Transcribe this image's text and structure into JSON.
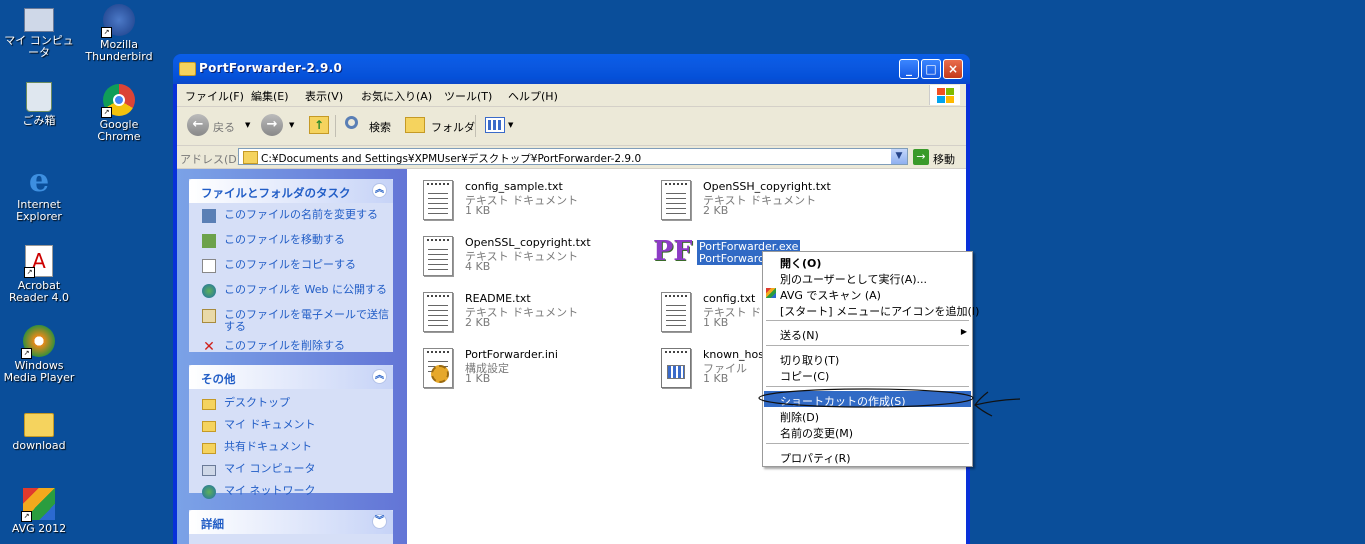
{
  "desktop": {
    "icons": [
      {
        "label": "マイ コンピュータ"
      },
      {
        "label": "Mozilla Thunderbird"
      },
      {
        "label": "ごみ箱"
      },
      {
        "label": "Google Chrome"
      },
      {
        "label": "Internet Explorer"
      },
      {
        "label": "Acrobat Reader 4.0"
      },
      {
        "label": "Windows Media Player"
      },
      {
        "label": "download"
      },
      {
        "label": "AVG 2012"
      }
    ]
  },
  "window": {
    "title": "PortForwarder-2.9.0",
    "menu": [
      "ファイル(F)",
      "編集(E)",
      "表示(V)",
      "お気に入り(A)",
      "ツール(T)",
      "ヘルプ(H)"
    ],
    "toolbar": {
      "back": "戻る",
      "search": "検索",
      "folder": "フォルダ"
    },
    "address": {
      "label": "アドレス(D)",
      "value": "C:¥Documents and Settings¥XPMUser¥デスクトップ¥PortForwarder-2.9.0",
      "go": "移動"
    },
    "taskpane": {
      "file_tasks": {
        "title": "ファイルとフォルダのタスク",
        "items": [
          "このファイルの名前を変更する",
          "このファイルを移動する",
          "このファイルをコピーする",
          "このファイルを Web に公開する",
          "このファイルを電子メールで送信する",
          "このファイルを削除する"
        ]
      },
      "other": {
        "title": "その他",
        "items": [
          "デスクトップ",
          "マイ ドキュメント",
          "共有ドキュメント",
          "マイ コンピュータ",
          "マイ ネットワーク"
        ]
      },
      "details": {
        "title": "詳細"
      }
    },
    "files": [
      {
        "name": "config_sample.txt",
        "type": "テキスト ドキュメント",
        "size": "1 KB"
      },
      {
        "name": "OpenSSH_copyright.txt",
        "type": "テキスト ドキュメント",
        "size": "2 KB"
      },
      {
        "name": "OpenSSL_copyright.txt",
        "type": "テキスト ドキュメント",
        "size": "4 KB"
      },
      {
        "name": "PortForwarder.exe",
        "type": "PortForwarder",
        "size": ""
      },
      {
        "name": "README.txt",
        "type": "テキスト ドキュメント",
        "size": "2 KB"
      },
      {
        "name": "config.txt",
        "type": "テキスト ドキュメント",
        "size": "1 KB"
      },
      {
        "name": "PortForwarder.ini",
        "type": "構成設定",
        "size": "1 KB"
      },
      {
        "name": "known_hosts",
        "type": "ファイル",
        "size": "1 KB"
      }
    ]
  },
  "context_menu": {
    "items": [
      "開く(O)",
      "別のユーザーとして実行(A)...",
      "AVG でスキャン (A)",
      "[スタート] メニューにアイコンを追加(I)",
      "送る(N)",
      "切り取り(T)",
      "コピー(C)",
      "ショートカットの作成(S)",
      "削除(D)",
      "名前の変更(M)",
      "プロパティ(R)"
    ]
  },
  "colors": {
    "desktop": "#0a4e9a",
    "selection": "#316ac5",
    "link": "#215dc6"
  }
}
